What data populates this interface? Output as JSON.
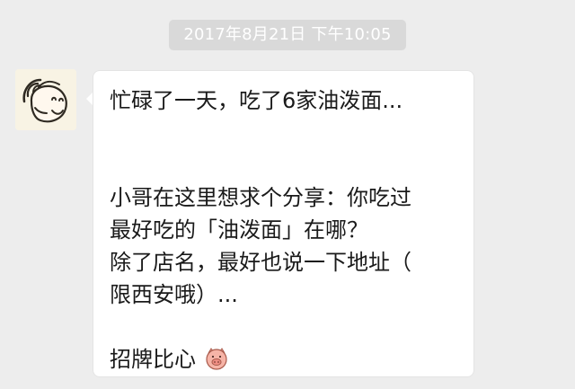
{
  "chat": {
    "timestamp": "2017年8月21日 下午10:05",
    "message": {
      "line1": "忙碌了一天，吃了6家油泼面...",
      "line2": "小哥在这里想求个分享：你吃过",
      "line3": "最好吃的「油泼面」在哪？",
      "line4": "除了店名，最好也说一下地址（",
      "line5": "限西安哦）...",
      "line6": "招牌比心"
    }
  },
  "icons": {
    "avatar": "cartoon-avatar",
    "emoji": "pig-emoji"
  },
  "colors": {
    "background": "#ededed",
    "bubble": "#ffffff",
    "timestamp_pill": "#d9d9d9"
  }
}
